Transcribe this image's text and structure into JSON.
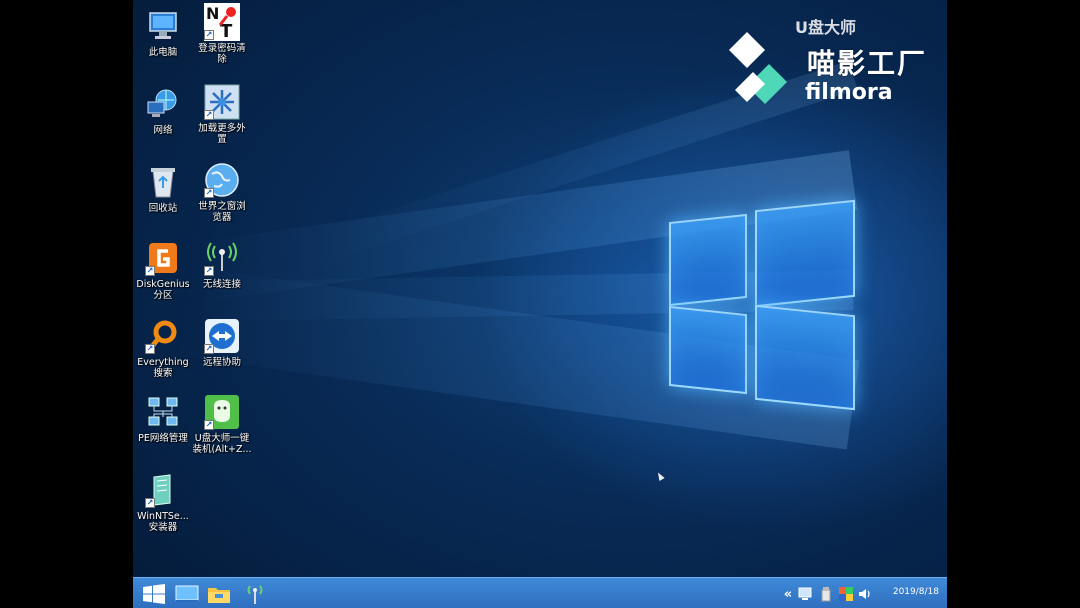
{
  "desktop": {
    "icons": [
      {
        "label": "此电脑",
        "icon": "computer-icon"
      },
      {
        "label": "登录密码清\n除",
        "icon": "nt-password-icon"
      },
      {
        "label": "网络",
        "icon": "network-icon"
      },
      {
        "label": "加载更多外\n置",
        "icon": "load-external-icon"
      },
      {
        "label": "回收站",
        "icon": "recycle-bin-icon"
      },
      {
        "label": "世界之窗浏\n览器",
        "icon": "browser-globe-icon"
      },
      {
        "label": "DiskGenius\n分区",
        "icon": "diskgenius-icon"
      },
      {
        "label": "无线连接",
        "icon": "wireless-icon"
      },
      {
        "label": "Everything\n搜索",
        "icon": "everything-search-icon"
      },
      {
        "label": "远程协助",
        "icon": "teamviewer-icon"
      },
      {
        "label": "PE网络管理",
        "icon": "pe-network-icon"
      },
      {
        "label": "U盘大师一键\n装机(Alt+Z...",
        "icon": "udashi-install-icon"
      },
      {
        "label": "WinNTSe...\n安装器",
        "icon": "winntsetup-icon"
      }
    ]
  },
  "watermark": {
    "top_text": "U盘大师",
    "brand": "喵影工厂",
    "product": "filmora"
  },
  "taskbar": {
    "clock": "2019/8/18",
    "tray_arrow": "«"
  },
  "colors": {
    "taskbar": "#3f8ad8",
    "desktop_bg": "#0a2f5e",
    "glow": "#4fb3ff",
    "filmora_accent": "#4fd8b8"
  }
}
